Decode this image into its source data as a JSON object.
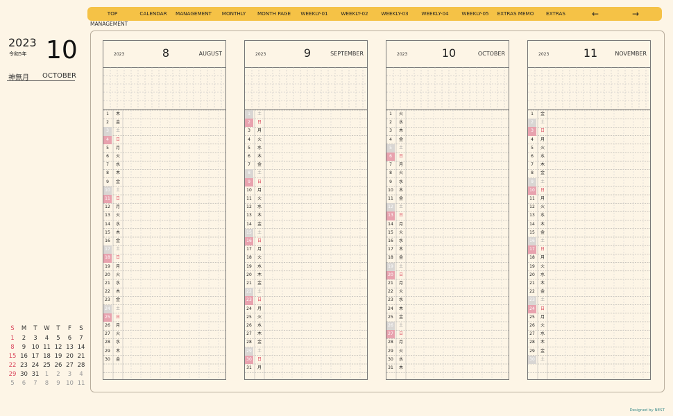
{
  "nav": {
    "items": [
      "TOP",
      "CALENDAR",
      "MANAGEMENT",
      "MONTHLY",
      "MONTH PAGE",
      "WEEKLY-01",
      "WEEKLY-02",
      "WEEKLY-03",
      "WEEKLY-04",
      "WEEKLY-05",
      "EXTRAS MEMO",
      "EXTRAS"
    ],
    "prev": "←",
    "next": "→"
  },
  "section_label": "MANAGEMENT",
  "sidebar": {
    "year": "2023",
    "era": "令和5年",
    "month_number": "10",
    "month_kanji": "神無月",
    "month_english": "OCTOBER"
  },
  "mini_calendar": {
    "weekdays": [
      "S",
      "M",
      "T",
      "W",
      "T",
      "F",
      "S"
    ],
    "rows": [
      [
        "1",
        "2",
        "3",
        "4",
        "5",
        "6",
        "7"
      ],
      [
        "8",
        "9",
        "10",
        "11",
        "12",
        "13",
        "14"
      ],
      [
        "15",
        "16",
        "17",
        "18",
        "19",
        "20",
        "21"
      ],
      [
        "22",
        "23",
        "24",
        "25",
        "26",
        "27",
        "28"
      ],
      [
        "29",
        "30",
        "31",
        "1",
        "2",
        "3",
        "4"
      ],
      [
        "5",
        "6",
        "7",
        "8",
        "9",
        "10",
        "11"
      ]
    ]
  },
  "columns": [
    {
      "year": "2023",
      "number": "8",
      "name": "AUGUST",
      "days": [
        [
          "1",
          "木"
        ],
        [
          "2",
          "金"
        ],
        [
          "3",
          "土"
        ],
        [
          "4",
          "日"
        ],
        [
          "5",
          "月"
        ],
        [
          "6",
          "火"
        ],
        [
          "7",
          "水"
        ],
        [
          "8",
          "木"
        ],
        [
          "9",
          "金"
        ],
        [
          "10",
          "土"
        ],
        [
          "11",
          "日"
        ],
        [
          "12",
          "月"
        ],
        [
          "13",
          "火"
        ],
        [
          "14",
          "水"
        ],
        [
          "15",
          "木"
        ],
        [
          "16",
          "金"
        ],
        [
          "17",
          "土"
        ],
        [
          "18",
          "日"
        ],
        [
          "19",
          "月"
        ],
        [
          "20",
          "火"
        ],
        [
          "21",
          "水"
        ],
        [
          "22",
          "木"
        ],
        [
          "23",
          "金"
        ],
        [
          "24",
          "土"
        ],
        [
          "25",
          "日"
        ],
        [
          "26",
          "月"
        ],
        [
          "27",
          "火"
        ],
        [
          "28",
          "水"
        ],
        [
          "29",
          "木"
        ],
        [
          "30",
          "金"
        ]
      ]
    },
    {
      "year": "2023",
      "number": "9",
      "name": "SEPTEMBER",
      "days": [
        [
          "1",
          "土"
        ],
        [
          "2",
          "日"
        ],
        [
          "3",
          "月"
        ],
        [
          "4",
          "火"
        ],
        [
          "5",
          "水"
        ],
        [
          "6",
          "木"
        ],
        [
          "7",
          "金"
        ],
        [
          "8",
          "土"
        ],
        [
          "9",
          "日"
        ],
        [
          "10",
          "月"
        ],
        [
          "11",
          "火"
        ],
        [
          "12",
          "水"
        ],
        [
          "13",
          "木"
        ],
        [
          "14",
          "金"
        ],
        [
          "15",
          "土"
        ],
        [
          "16",
          "日"
        ],
        [
          "17",
          "月"
        ],
        [
          "18",
          "火"
        ],
        [
          "19",
          "水"
        ],
        [
          "20",
          "木"
        ],
        [
          "21",
          "金"
        ],
        [
          "22",
          "土"
        ],
        [
          "23",
          "日"
        ],
        [
          "24",
          "月"
        ],
        [
          "25",
          "火"
        ],
        [
          "26",
          "水"
        ],
        [
          "27",
          "木"
        ],
        [
          "28",
          "金"
        ],
        [
          "29",
          "土"
        ],
        [
          "30",
          "日"
        ],
        [
          "31",
          "月"
        ]
      ]
    },
    {
      "year": "2023",
      "number": "10",
      "name": "OCTOBER",
      "days": [
        [
          "1",
          "火"
        ],
        [
          "2",
          "水"
        ],
        [
          "3",
          "木"
        ],
        [
          "4",
          "金"
        ],
        [
          "5",
          "土"
        ],
        [
          "6",
          "日"
        ],
        [
          "7",
          "月"
        ],
        [
          "8",
          "火"
        ],
        [
          "9",
          "水"
        ],
        [
          "10",
          "木"
        ],
        [
          "11",
          "金"
        ],
        [
          "12",
          "土"
        ],
        [
          "13",
          "日"
        ],
        [
          "14",
          "月"
        ],
        [
          "15",
          "火"
        ],
        [
          "16",
          "水"
        ],
        [
          "17",
          "木"
        ],
        [
          "18",
          "金"
        ],
        [
          "19",
          "土"
        ],
        [
          "20",
          "日"
        ],
        [
          "21",
          "月"
        ],
        [
          "22",
          "火"
        ],
        [
          "23",
          "水"
        ],
        [
          "24",
          "木"
        ],
        [
          "25",
          "金"
        ],
        [
          "26",
          "土"
        ],
        [
          "27",
          "日"
        ],
        [
          "28",
          "月"
        ],
        [
          "29",
          "火"
        ],
        [
          "30",
          "水"
        ],
        [
          "31",
          "木"
        ]
      ]
    },
    {
      "year": "2023",
      "number": "11",
      "name": "NOVEMBER",
      "days": [
        [
          "1",
          "金"
        ],
        [
          "2",
          "土"
        ],
        [
          "3",
          "日"
        ],
        [
          "4",
          "月"
        ],
        [
          "5",
          "火"
        ],
        [
          "6",
          "水"
        ],
        [
          "7",
          "木"
        ],
        [
          "8",
          "金"
        ],
        [
          "9",
          "土"
        ],
        [
          "10",
          "日"
        ],
        [
          "11",
          "月"
        ],
        [
          "12",
          "火"
        ],
        [
          "13",
          "水"
        ],
        [
          "14",
          "木"
        ],
        [
          "15",
          "金"
        ],
        [
          "16",
          "土"
        ],
        [
          "17",
          "日"
        ],
        [
          "18",
          "月"
        ],
        [
          "19",
          "火"
        ],
        [
          "20",
          "水"
        ],
        [
          "21",
          "木"
        ],
        [
          "22",
          "金"
        ],
        [
          "23",
          "土"
        ],
        [
          "24",
          "日"
        ],
        [
          "25",
          "月"
        ],
        [
          "26",
          "火"
        ],
        [
          "27",
          "水"
        ],
        [
          "28",
          "木"
        ],
        [
          "29",
          "金"
        ],
        [
          "30",
          "土"
        ]
      ]
    }
  ],
  "credit": "Designed by NEST",
  "colors": {
    "nav": "#f5c246",
    "saturday": "#d9d6d3",
    "sunday": "#e8a2ae",
    "background": "#fdf5e6"
  }
}
